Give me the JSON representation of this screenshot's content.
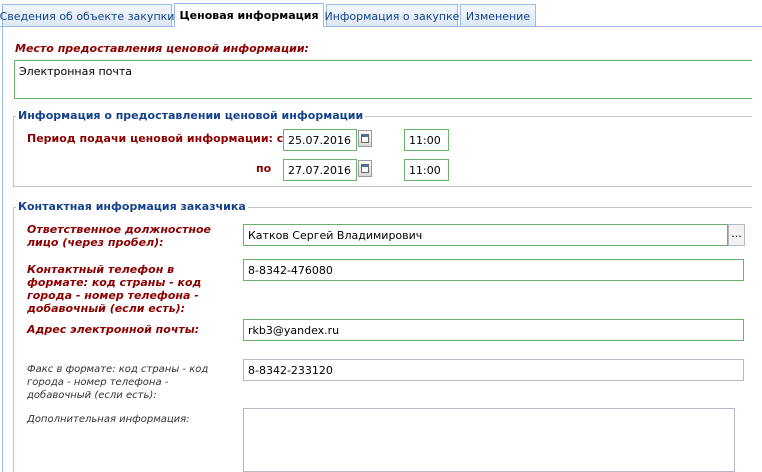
{
  "tabs": [
    {
      "label": "Сведения об объекте закупки",
      "active": false
    },
    {
      "label": "Ценовая информация",
      "active": true
    },
    {
      "label": "Информация о закупке",
      "active": false
    },
    {
      "label": "Изменение",
      "active": false
    }
  ],
  "place": {
    "label": "Место предоставления ценовой информации:",
    "value": "Электронная почта"
  },
  "price_info": {
    "legend": "Информация о предоставлении ценовой информации",
    "period_label": "Период подачи ценовой информации: с",
    "from_date": "25.07.2016",
    "from_time": "11:00",
    "to_label": "по",
    "to_date": "27.07.2016",
    "to_time": "11:00"
  },
  "contact": {
    "legend": "Контактная информация заказчика",
    "person_label": "Ответственное должностное лицо (через пробел):",
    "person_value": "Катков Сергей Владимирович",
    "lookup_button": "...",
    "phone_label": "Контактный телефон в формате: код страны - код города - номер телефона - добавочный (если есть):",
    "phone_value": "8-8342-476080",
    "email_label": "Адрес электронной почты:",
    "email_value": "rkb3@yandex.ru",
    "fax_label": "Факс в формате: код страны - код города - номер телефона - добавочный (если есть):",
    "fax_value": "8-8342-233120",
    "extra_label": "Дополнительная информация:",
    "extra_value": ""
  },
  "colors": {
    "required_label": "#8b0000",
    "legend": "#15428b",
    "field_border_valid": "#6bb26b",
    "tab_border": "#99bbe8"
  }
}
